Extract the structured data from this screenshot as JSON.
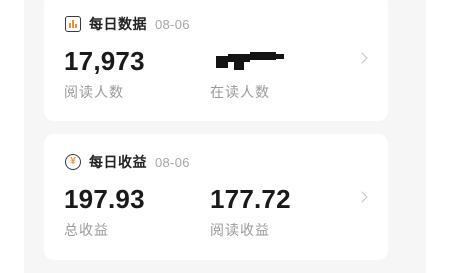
{
  "daily_stats": {
    "title": "每日数据",
    "date": "08-06",
    "icon": "bar-chart-icon",
    "metrics": [
      {
        "value": "17,973",
        "label": "阅读人数"
      },
      {
        "value": "",
        "label": "在读人数"
      }
    ]
  },
  "daily_income": {
    "title": "每日收益",
    "date": "08-06",
    "icon": "yen-coin-icon",
    "metrics": [
      {
        "value": "197.93",
        "label": "总收益"
      },
      {
        "value": "177.72",
        "label": "阅读收益"
      }
    ]
  }
}
